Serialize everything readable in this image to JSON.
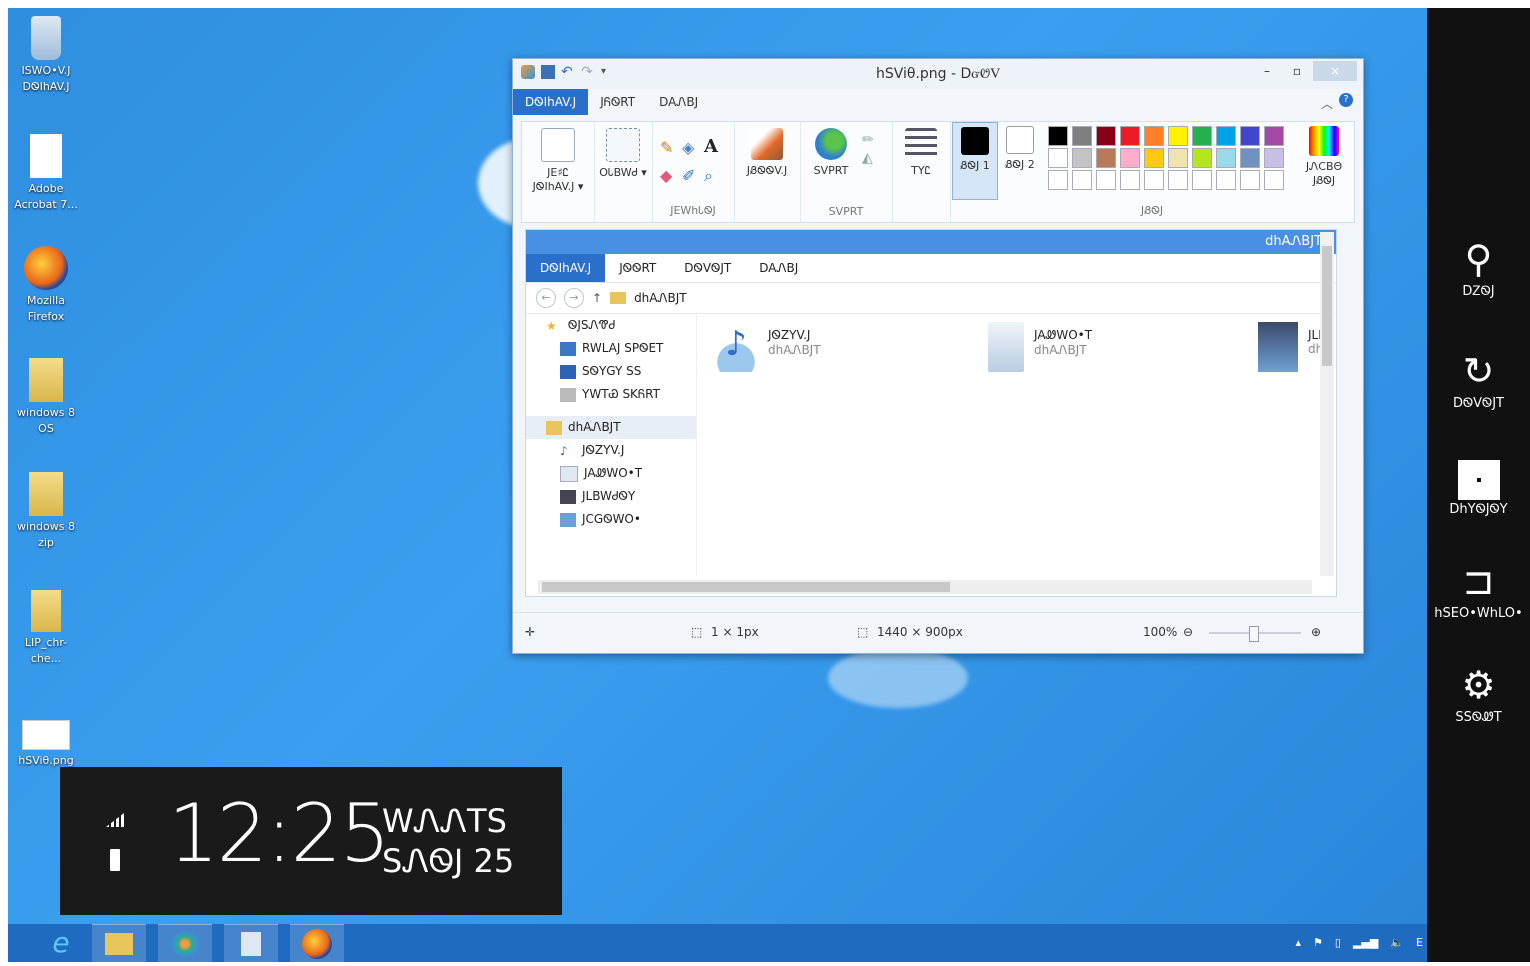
{
  "desktop_icons": [
    {
      "name": "recycle-bin",
      "label": "ISWO•V.J DᏫIhAV.J"
    },
    {
      "name": "adobe-acrobat",
      "label": "Adobe Acrobat 7..."
    },
    {
      "name": "mozilla-firefox",
      "label": "Mozilla Firefox"
    },
    {
      "name": "windows8-os",
      "label": "windows 8 OS"
    },
    {
      "name": "windows8-zip",
      "label": "windows 8 zip"
    },
    {
      "name": "lip-chr-che",
      "label": "LIP_chr-che..."
    },
    {
      "name": "hsvio-png",
      "label": "hSViθ.png"
    }
  ],
  "paint": {
    "title": "hSViθ.png - DᏻᏬᏙ",
    "tabs": [
      "DᏫIhAV.J",
      "JᏲᏫRT",
      "DAᏁBJ"
    ],
    "groups": {
      "clipboard_label": "JE♯Ꮭ JᏫIhAV.J ▾",
      "select_label": "OᏓBWᏧ ▾",
      "tools_label": "JEWhᏓᏫJ",
      "brushes_label": "JᏰᏫᏫV.J",
      "shapes_label": "SVPRT",
      "shapes_group_label": "SVPRT",
      "size_label": "TYᏝ",
      "color1_label": "ᏰᏫJ 1",
      "color2_label": "ᏰᏫJ 2",
      "colors_group_label": "JᏰᏫJ",
      "edit_colors_label": "JᏁCBΘ JᏰᏫJ"
    },
    "palette_colors": [
      "#000000",
      "#7f7f7f",
      "#880015",
      "#ed1c24",
      "#ff7f27",
      "#fff200",
      "#22b14c",
      "#00a2e8",
      "#3f48cc",
      "#a349a4",
      "#ffffff",
      "#c3c3c3",
      "#b97a57",
      "#ffaec9",
      "#ffc90e",
      "#efe4b0",
      "#b5e61d",
      "#99d9ea",
      "#7092be",
      "#c8bfe7"
    ],
    "status": {
      "cursor": "1 × 1px",
      "size": "1440 × 900px",
      "zoom": "100%"
    }
  },
  "explorer": {
    "title": "dhAᏁBJT",
    "tabs": [
      "DᏫIhAV.J",
      "JᏫᏫRT",
      "DᏫVᏫJT",
      "DAᏁBJ"
    ],
    "address": "dhAᏁBJT",
    "nav": [
      {
        "label": "ᏫJSᏁᏡᏧ",
        "sub": false,
        "icon": "star-icon"
      },
      {
        "label": "RWLAJ SPᏫET",
        "sub": true,
        "icon": "downloads-icon"
      },
      {
        "label": "SᏫYGY SS",
        "sub": true,
        "icon": "desktop-icon"
      },
      {
        "label": "YWTᏯ SKᏲRT",
        "sub": true,
        "icon": "recent-icon"
      },
      {
        "label": "dhAᏁBJT",
        "sub": false,
        "icon": "libraries-icon",
        "selected": true
      },
      {
        "label": "JᏫZYV.J",
        "sub": true,
        "icon": "music-icon"
      },
      {
        "label": "JAᏪWO•T",
        "sub": true,
        "icon": "documents-icon"
      },
      {
        "label": "JLBWᏧᏫY",
        "sub": true,
        "icon": "videos-icon"
      },
      {
        "label": "JCGᏫWO•",
        "sub": true,
        "icon": "pictures-icon"
      }
    ],
    "files": [
      {
        "name": "JᏫZYV.J",
        "sub": "dhAᏁBJT",
        "icon": "music-library-icon"
      },
      {
        "name": "JAᏪWO•T",
        "sub": "dhAᏁBJT",
        "icon": "documents-library-icon"
      },
      {
        "name": "JLB",
        "sub": "dhA",
        "icon": "videos-library-icon"
      }
    ]
  },
  "clock": {
    "time": "12:25",
    "weekday": "WᏁᏁTS",
    "date": "SᏁᏫJ 25"
  },
  "charms": [
    {
      "label": "DᏃᏫJ",
      "icon": "search-icon"
    },
    {
      "label": "DᏫVᏫJT",
      "icon": "share-icon"
    },
    {
      "label": "DhYᏫJᏫY",
      "icon": "windows-start-icon"
    },
    {
      "label": "hSEO•WhLO•",
      "icon": "devices-icon"
    },
    {
      "label": "SSᏫᏪT",
      "icon": "settings-icon"
    }
  ],
  "taskbar": {
    "apps": [
      "internet-explorer",
      "file-explorer",
      "paint",
      "calculator",
      "firefox"
    ],
    "tray_text": "E"
  }
}
